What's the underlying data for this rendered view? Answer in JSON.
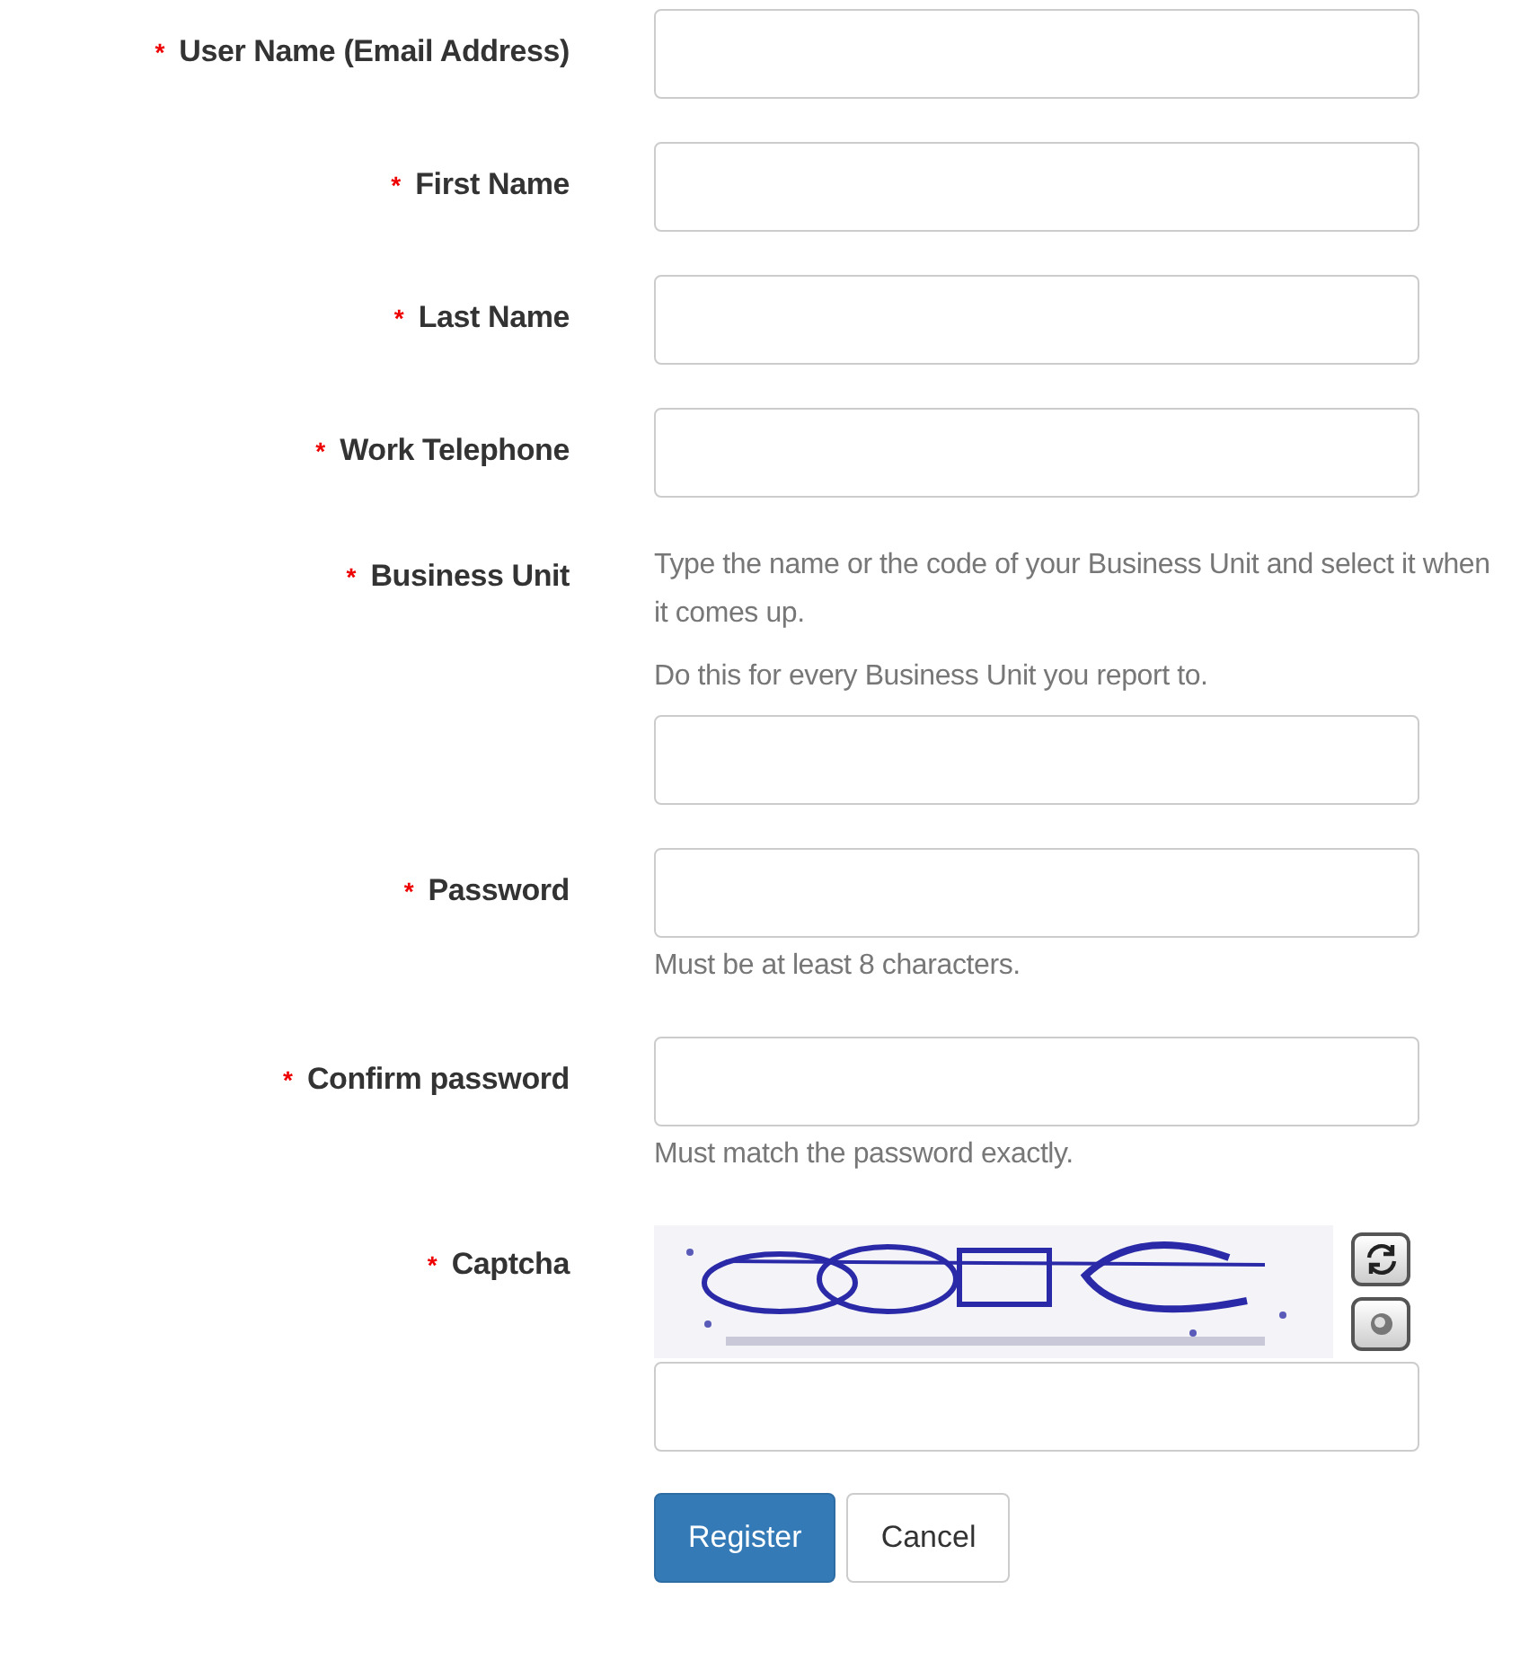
{
  "fields": [
    {
      "kind": "text",
      "label": "User Name (Email Address)",
      "required": true
    },
    {
      "kind": "text",
      "label": "First Name",
      "required": true
    },
    {
      "kind": "text",
      "label": "Last Name",
      "required": true
    },
    {
      "kind": "text",
      "label": "Work Telephone",
      "required": true
    },
    {
      "kind": "text",
      "label": "Business Unit",
      "required": true,
      "help": [
        "Type the name or the code of your Business Unit and select it when it comes up.",
        "Do this for every Business Unit you report to."
      ]
    },
    {
      "kind": "password",
      "label": "Password",
      "required": true,
      "hint": "Must be at least 8 characters."
    },
    {
      "kind": "password",
      "label": "Confirm password",
      "required": true,
      "hint": "Must match the password exactly."
    },
    {
      "kind": "captcha",
      "label": "Captcha",
      "required": true
    }
  ],
  "required_mark": "*",
  "buttons": [
    {
      "label": "Register",
      "primary": true
    },
    {
      "label": "Cancel",
      "primary": false
    }
  ]
}
